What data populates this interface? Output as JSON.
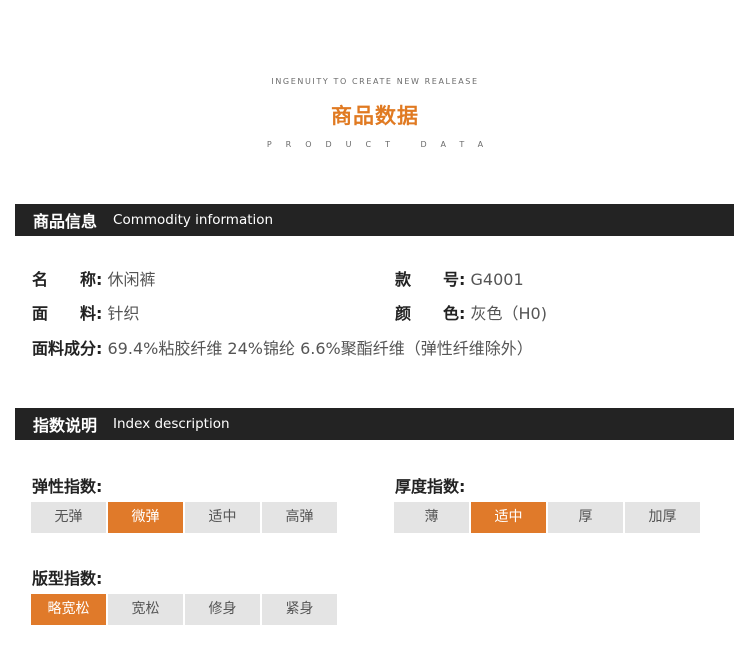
{
  "header": {
    "top_text": "INGENUITY TO CREATE NEW REALEASE",
    "title": "商品数据",
    "subtitle": "PRODUCT DATA"
  },
  "section_info": {
    "cn": "商品信息",
    "en": "Commodity information"
  },
  "info": {
    "name_label": "名　　称:",
    "name_value": "休闲裤",
    "code_label": "款　　号:",
    "code_value": "G4001",
    "fabric_label": "面　　料:",
    "fabric_value": "针织",
    "color_label": "颜　　色:",
    "color_value": "灰色（H0)",
    "composition_label": "面料成分:",
    "composition_value": "69.4%粘胶纤维 24%锦纶 6.6%聚酯纤维（弹性纤维除外）"
  },
  "section_index": {
    "cn": "指数说明",
    "en": "Index description"
  },
  "elasticity": {
    "title": "弹性指数:",
    "options": [
      "无弹",
      "微弹",
      "适中",
      "高弹"
    ],
    "selected": "微弹"
  },
  "thickness": {
    "title": "厚度指数:",
    "options": [
      "薄",
      "适中",
      "厚",
      "加厚"
    ],
    "selected": "适中"
  },
  "fit": {
    "title": "版型指数:",
    "options": [
      "略宽松",
      "宽松",
      "修身",
      "紧身"
    ],
    "selected": "略宽松"
  },
  "colors": {
    "accent": "#e07a2a",
    "bar": "#232323",
    "button_bg": "#e4e4e4"
  }
}
